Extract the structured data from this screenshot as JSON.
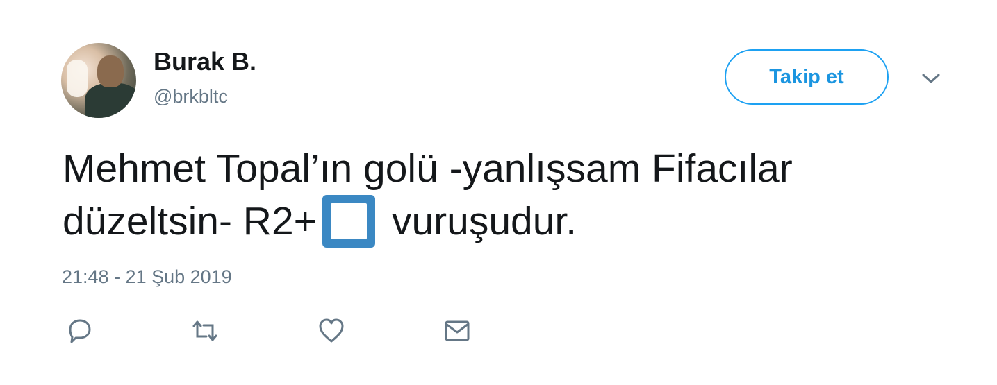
{
  "user": {
    "display_name": "Burak B.",
    "handle": "@brkbltc",
    "avatar_icon": "profile-photo"
  },
  "follow_button": {
    "label": "Takip et",
    "color": "#1da1f2"
  },
  "menu": {
    "icon": "chevron-down-icon"
  },
  "tweet": {
    "line1": "Mehmet Topal’ın golü -yanlışsam Fifacılar",
    "line2_before": "düzeltsin- R2+",
    "emoji": "white-square-button-emoji",
    "line2_after": "vuruşudur.",
    "timestamp": "21:48 - 21 Şub 2019"
  },
  "actions": [
    {
      "name": "reply",
      "icon": "reply-icon"
    },
    {
      "name": "retweet",
      "icon": "retweet-icon"
    },
    {
      "name": "like",
      "icon": "heart-icon"
    },
    {
      "name": "direct-message",
      "icon": "envelope-icon"
    }
  ],
  "colors": {
    "text": "#14171a",
    "secondary": "#657786",
    "accent": "#1da1f2",
    "emoji_blue": "#3b88c3"
  }
}
